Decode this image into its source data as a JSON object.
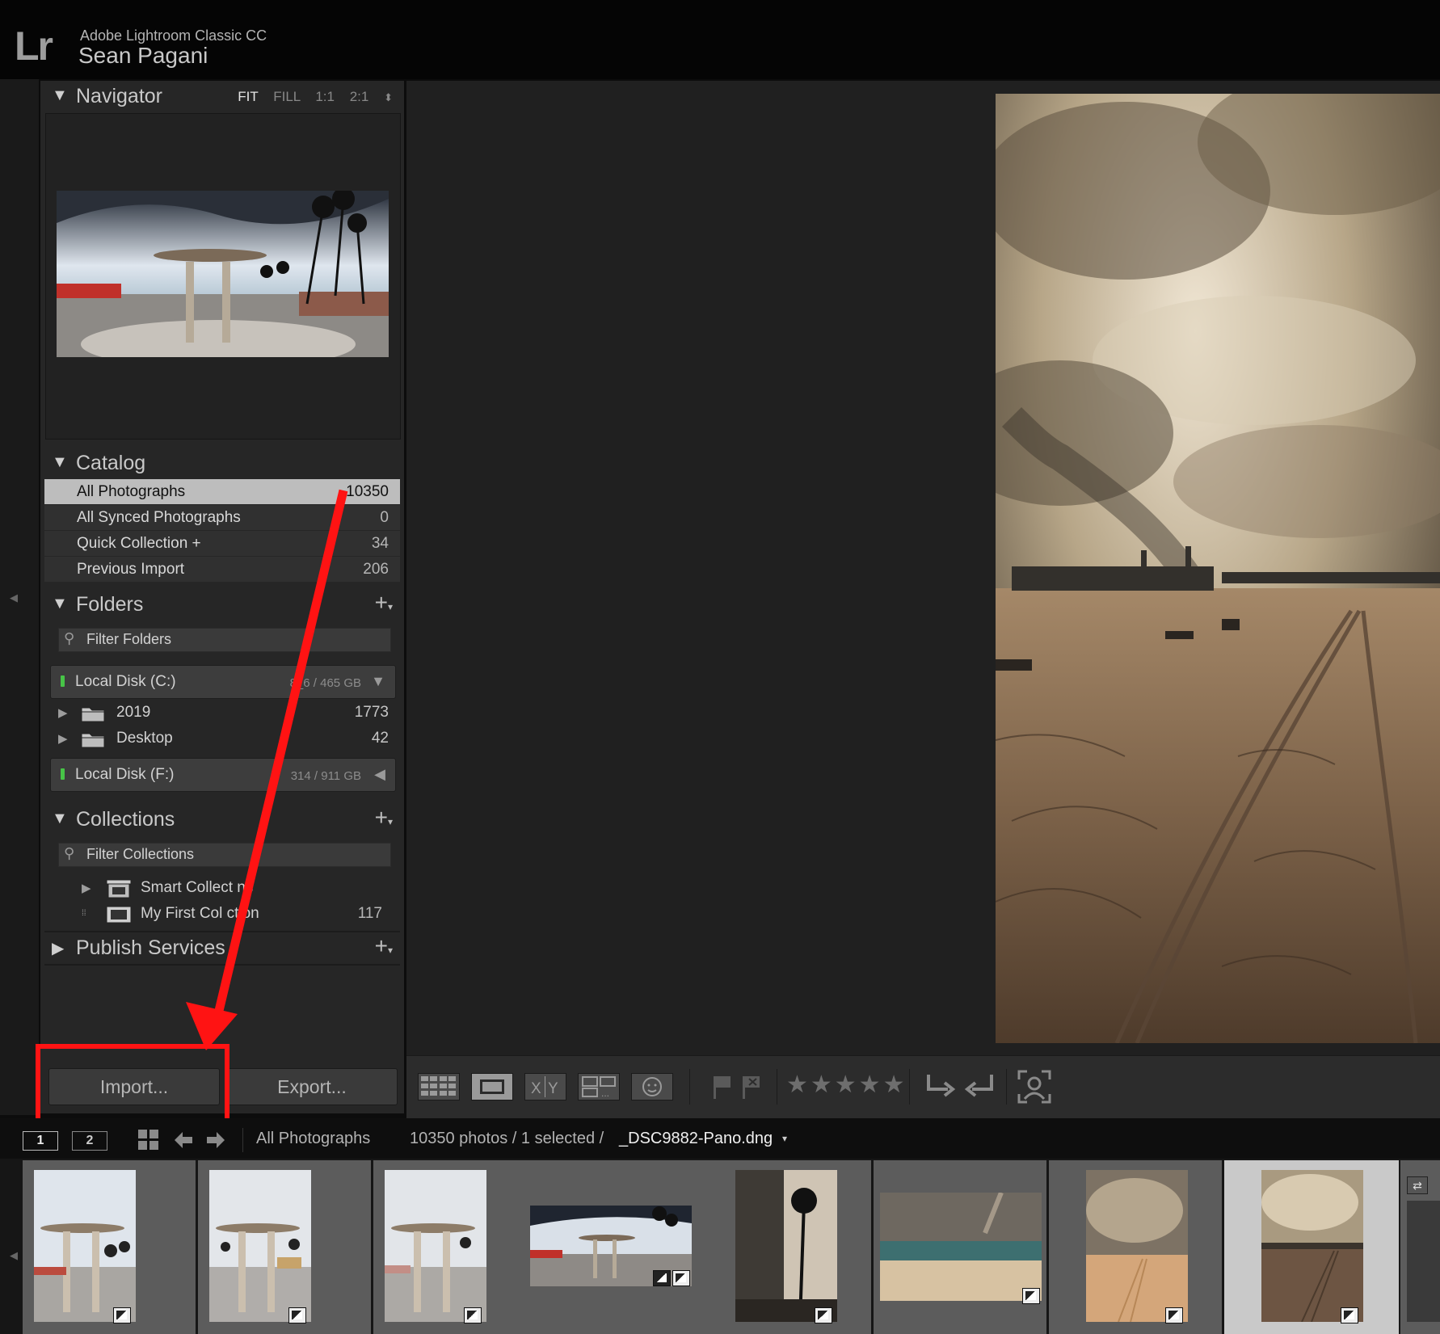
{
  "app": {
    "logo_text": "Lr",
    "name": "Adobe Lightroom Classic CC",
    "user": "Sean Pagani"
  },
  "navigator": {
    "title": "Navigator",
    "modes": [
      "FIT",
      "FILL",
      "1:1",
      "2:1"
    ],
    "active_mode": "FIT"
  },
  "catalog": {
    "title": "Catalog",
    "items": [
      {
        "label": "All Photographs",
        "count": "10350"
      },
      {
        "label": "All Synced Photographs",
        "count": "0"
      },
      {
        "label": "Quick Collection +",
        "count": "34"
      },
      {
        "label": "Previous Import",
        "count": "206"
      }
    ]
  },
  "folders": {
    "title": "Folders",
    "filter_placeholder": "Filter Folders",
    "volumes": [
      {
        "label": "Local Disk (C:)",
        "capacity": "8_6 / 465 GB"
      },
      {
        "label": "Local Disk (F:)",
        "capacity": "314 / 911 GB"
      }
    ],
    "items": [
      {
        "label": "2019",
        "count": "1773"
      },
      {
        "label": "Desktop",
        "count": "42"
      }
    ]
  },
  "collections": {
    "title": "Collections",
    "filter_placeholder": "Filter Collections",
    "items": [
      {
        "label": "Smart Collect  ns",
        "count": ""
      },
      {
        "label": "My First Col   ction",
        "count": "117"
      }
    ]
  },
  "publish_services": {
    "title": "Publish Services"
  },
  "buttons": {
    "import": "Import...",
    "export": "Export..."
  },
  "toolbar": {
    "stars": "★★★★★",
    "icons": [
      "grid-view-icon",
      "loupe-view-icon",
      "compare-view-icon",
      "survey-view-icon",
      "people-view-icon",
      "flag-icon",
      "reject-flag-icon",
      "rotate-left-icon",
      "rotate-right-icon",
      "face-region-icon"
    ]
  },
  "filmstrip_bar": {
    "monitor1": "1",
    "monitor2": "2",
    "source": "All Photographs",
    "count_text": "10350 photos / 1 selected /",
    "file_name": "_DSC9882-Pano.dng",
    "menu_glyph": "▾"
  },
  "colors": {
    "highlight": "#ff1313",
    "arrow": "#ff1313",
    "selected_row": "#bdbdbd"
  }
}
